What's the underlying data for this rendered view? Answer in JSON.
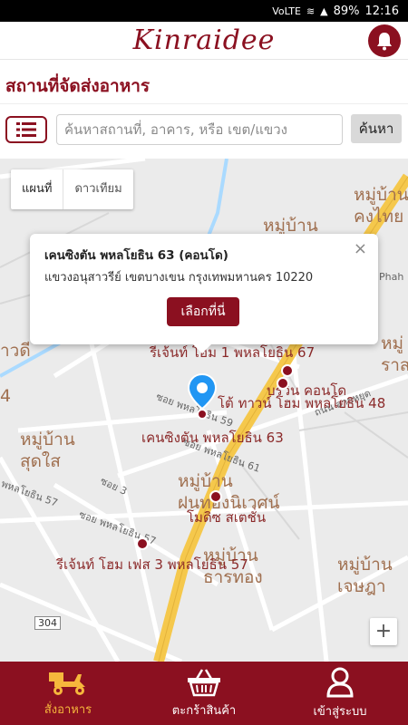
{
  "status_bar": {
    "battery": "89%",
    "time": "12:16",
    "network": "VoLTE"
  },
  "header": {
    "logo_text": "Kinraidee",
    "notification_icon": "bell-icon"
  },
  "page": {
    "title": "สถานที่จัดส่งอาหาร"
  },
  "search": {
    "placeholder": "ค้นหาสถานที่, อาคาร, หรือ เขต/แขวง",
    "button_label": "ค้นหา",
    "list_icon": "list-icon"
  },
  "map": {
    "type_map": "แผนที่",
    "type_satellite": "ดาวเทียม",
    "zoom_in": "+",
    "route_number": "304",
    "areas": {
      "top_right": "หมู่บ้าน\nคงไทย",
      "mid_top": "หมู่บ้าน",
      "right_mid": "หมู่\nราส",
      "left_mid": "หมู่บ้าน\nสุดใส",
      "center": "หมู่บ้าน\nฝนทองนิเวศน์",
      "bottom_mid": "หมู่บ้าน\nธารทอง",
      "bottom_right": "หมู่บ้าน\nเจษฎา",
      "left_edge": "าวดี",
      "left_edge2": "4"
    },
    "places": [
      "รีเจ้นท์ โฮม 1 พหลโยธิน 67",
      "บรวิน คอนโด",
      "โต้ ทาวน์ โฮม พหลโยธิน 48",
      "เคนซิงตัน พหลโยธิน 63",
      "โมดิซ สเตชั่น",
      "รีเจ้นท์ โฮม เฟส 3 พหลโยธิน 57"
    ],
    "roads": [
      "ซอย พหลโยธิน 59",
      "ซอย พหลโยธิน 61",
      "ซอย 3",
      "พหลโยธิน 57",
      "ซอย พหลโยธิน 57",
      "ถนน สายหยุด",
      "Phah"
    ]
  },
  "popup": {
    "title": "เคนซิงตัน พหลโยธิน 63 (คอนโด)",
    "address": "แขวงอนุสาวรีย์ เขตบางเขน กรุงเทพมหานคร 10220",
    "select_button": "เลือกที่นี่",
    "close": "×"
  },
  "bottom_nav": [
    {
      "label": "สั่งอาหาร",
      "icon": "delivery-scooter-icon",
      "active": true
    },
    {
      "label": "ตะกร้าสินค้า",
      "icon": "basket-icon",
      "active": false
    },
    {
      "label": "เข้าสู่ระบบ",
      "icon": "user-icon",
      "active": false
    }
  ],
  "colors": {
    "brand": "#8b1020",
    "active_nav": "#f6b73c",
    "map_road": "#f5c84c"
  }
}
